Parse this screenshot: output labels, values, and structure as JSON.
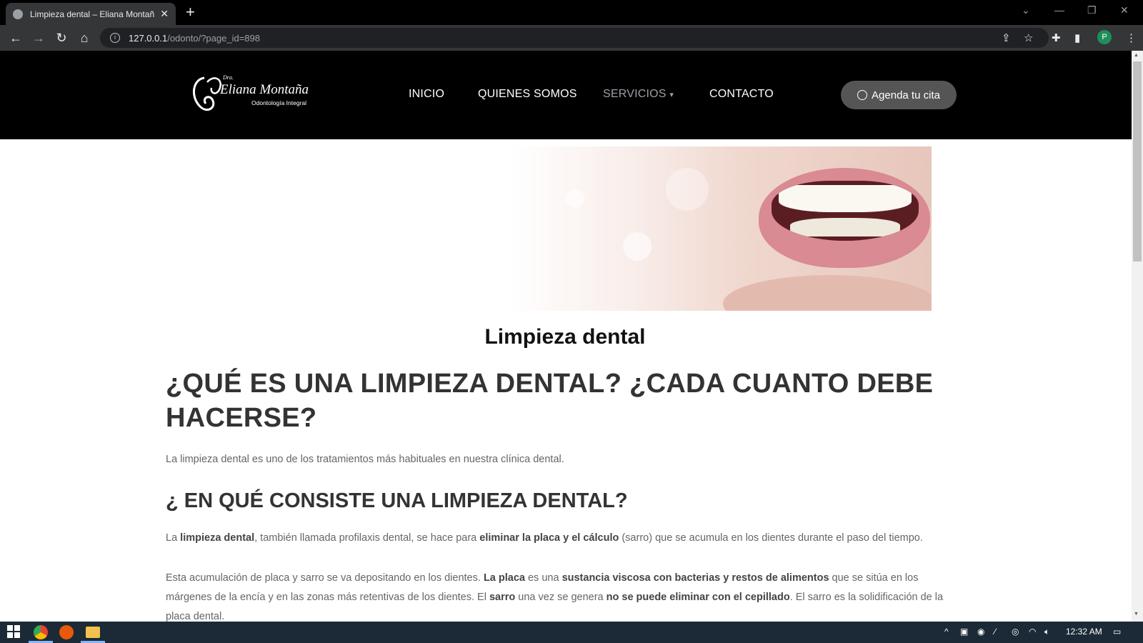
{
  "browser": {
    "tab_title": "Limpieza dental – Eliana Montañ",
    "url_host": "127.0.0.1",
    "url_path": "/odonto/?page_id=898",
    "profile_initial": "P"
  },
  "site": {
    "logo": {
      "prefix": "Dra.",
      "name": "Eliana Montaña",
      "tagline": "Odontología Integral"
    },
    "nav": [
      {
        "label": "INICIO"
      },
      {
        "label": "QUIENES SOMOS"
      },
      {
        "label": "SERVICIOS",
        "has_dropdown": true,
        "active": true
      },
      {
        "label": "CONTACTO"
      }
    ],
    "cta_label": "Agenda tu cita"
  },
  "article": {
    "page_title": "Limpieza dental",
    "heading1": "¿QUÉ ES UNA LIMPIEZA DENTAL? ¿CADA CUANTO DEBE HACERSE?",
    "intro": "La limpieza dental es uno de los tratamientos más habituales en nuestra clínica dental.",
    "heading2": "¿ EN QUÉ CONSISTE UNA LIMPIEZA DENTAL?",
    "p2": {
      "t1": "La ",
      "b1": "limpieza dental",
      "t2": ", también llamada profilaxis dental, se hace para ",
      "b2": "eliminar la placa y el cálculo",
      "t3": " (sarro) que se acumula en los dientes durante el paso del tiempo."
    },
    "p3": {
      "t1": "Esta acumulación de placa y sarro se va depositando en los dientes. ",
      "b1": "La placa",
      "t2": " es una ",
      "b2": "sustancia viscosa con bacterias y restos de alimentos",
      "t3": " que se sitúa en los márgenes de la encía y en las zonas más retentivas de los dientes.  El ",
      "b3": "sarro",
      "t4": " una vez se genera ",
      "b4": "no se puede eliminar con el cepillado",
      "t5": ". El sarro es la solidificación de la placa dental."
    }
  },
  "taskbar": {
    "time": "12:32 AM"
  },
  "colors": {
    "header_bg": "#000000",
    "cta_bg": "#555555",
    "nav_active": "#9aa0a6",
    "text": "#666666"
  }
}
